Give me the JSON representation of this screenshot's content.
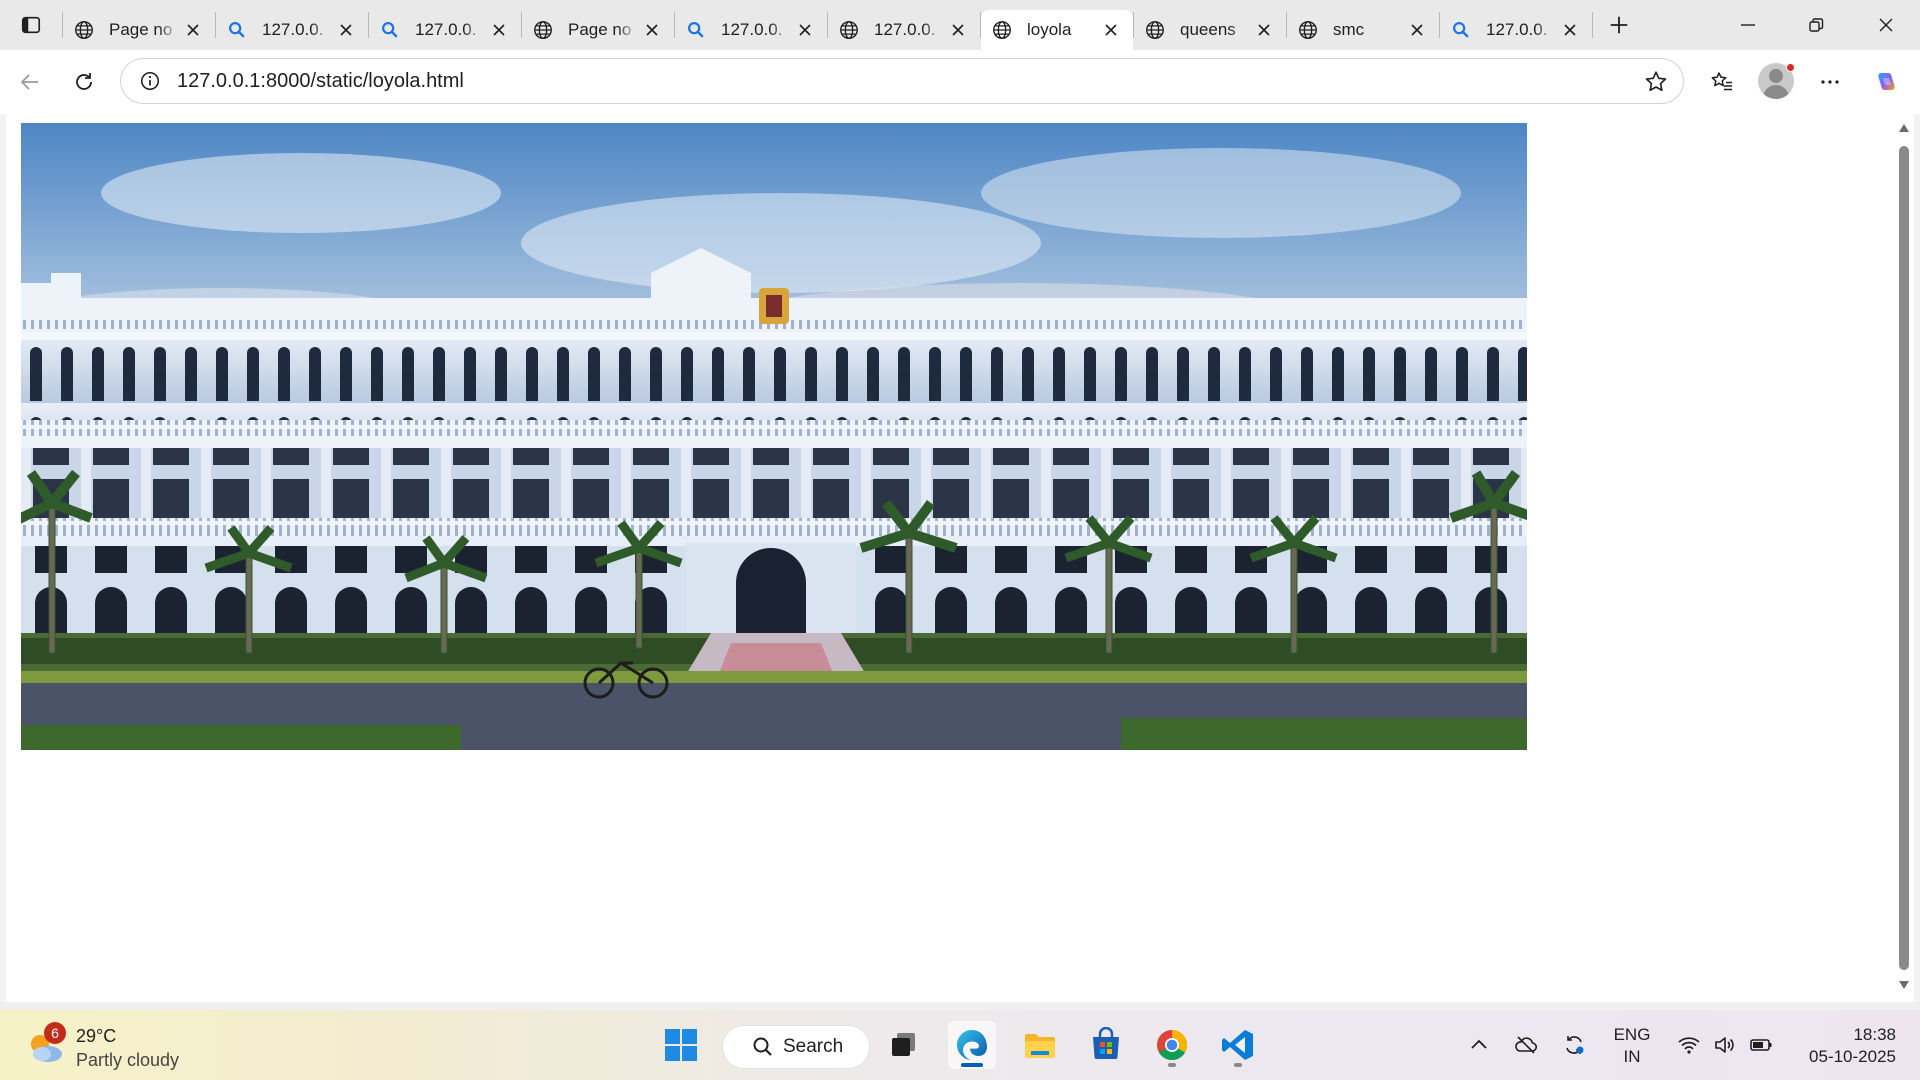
{
  "browser": {
    "tabs": [
      {
        "label": "Page no",
        "icon": "globe-icon",
        "active": false
      },
      {
        "label": "127.0.0.",
        "icon": "search-icon",
        "active": false
      },
      {
        "label": "127.0.0.",
        "icon": "search-icon",
        "active": false
      },
      {
        "label": "Page no",
        "icon": "globe-icon",
        "active": false
      },
      {
        "label": "127.0.0.",
        "icon": "search-icon",
        "active": false
      },
      {
        "label": "127.0.0.",
        "icon": "globe-icon",
        "active": false
      },
      {
        "label": "loyola",
        "icon": "globe-icon",
        "active": true
      },
      {
        "label": "queens",
        "icon": "globe-icon",
        "active": false
      },
      {
        "label": "smc",
        "icon": "globe-icon",
        "active": false
      },
      {
        "label": "127.0.0.",
        "icon": "search-icon",
        "active": false
      }
    ],
    "address_bar": {
      "url": "127.0.0.1:8000/static/loyola.html"
    },
    "accent_color": "#005fb8"
  },
  "page": {
    "hero_image": {
      "subject": "loyola-college-main-building-photo"
    }
  },
  "taskbar": {
    "weather": {
      "temperature": "29°C",
      "condition": "Partly cloudy",
      "notification_count": "6"
    },
    "search": {
      "label": "Search"
    },
    "pinned_apps": [
      "start-button",
      "task-view",
      "edge-browser",
      "file-explorer",
      "microsoft-store",
      "chrome-browser",
      "vscode"
    ],
    "tray": {
      "language_primary": "ENG",
      "language_secondary": "IN",
      "time": "18:38",
      "date": "05-10-2025"
    }
  }
}
